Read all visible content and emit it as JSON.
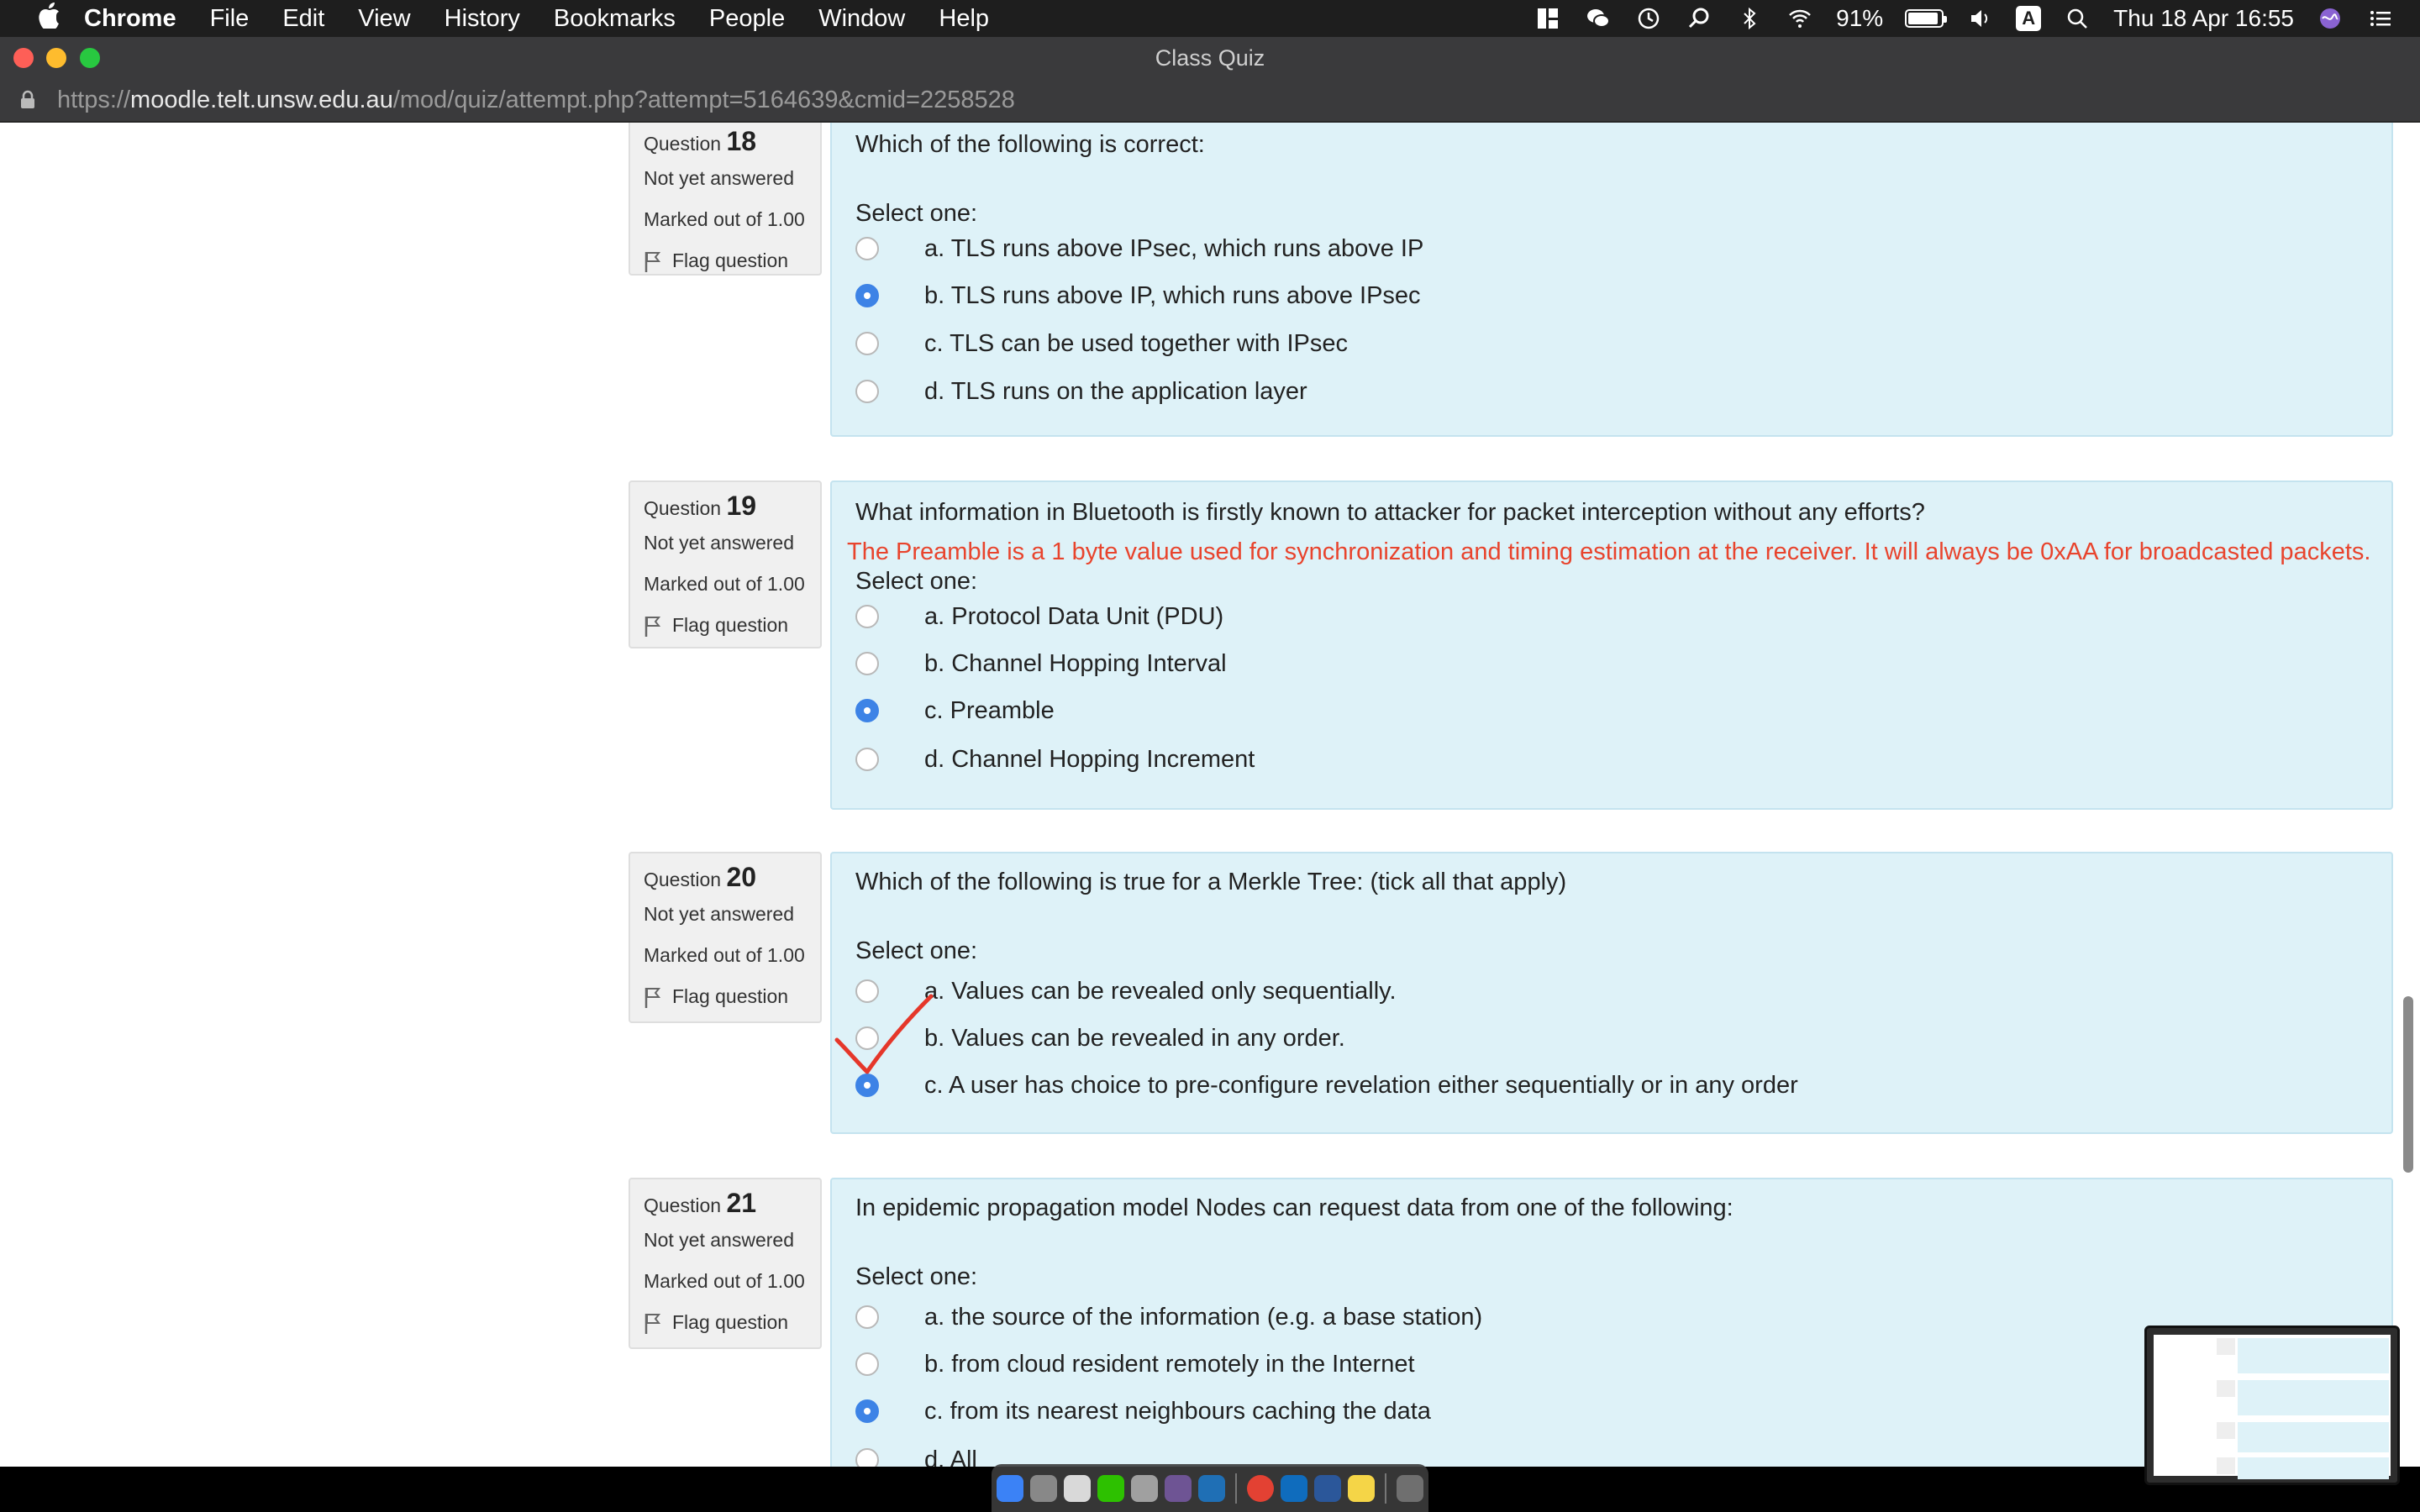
{
  "menubar": {
    "app_name": "Chrome",
    "items": [
      "File",
      "Edit",
      "View",
      "History",
      "Bookmarks",
      "People",
      "Window",
      "Help"
    ],
    "battery": "91%",
    "battery_level": 0.91,
    "ime": "A",
    "datetime": "Thu 18 Apr  16:55",
    "icons": [
      "apple-icon",
      "grid-icon",
      "wechat-icon",
      "time-machine-icon",
      "spotlight-alt-icon",
      "bluetooth-icon",
      "wifi-icon",
      "battery-icon",
      "volume-icon",
      "search-icon",
      "siri-icon",
      "list-icon"
    ]
  },
  "window": {
    "title": "Class Quiz"
  },
  "address": {
    "scheme": "https://",
    "host": "moodle.telt.unsw.edu.au",
    "path": "/mod/quiz/attempt.php?attempt=5164639&cmid=2258528"
  },
  "questions": [
    {
      "label": "Question",
      "number": "18",
      "status": "Not yet answered",
      "marks": "Marked out of 1.00",
      "flag": "Flag question",
      "text": "Which of the following is correct:",
      "hint": "",
      "select": "Select one:",
      "options": [
        {
          "text": "a. TLS runs above IPsec, which runs above IP",
          "checked": false
        },
        {
          "text": "b. TLS runs above IP, which runs above IPsec",
          "checked": true
        },
        {
          "text": "c. TLS can be used together with IPsec",
          "checked": false
        },
        {
          "text": "d. TLS runs on the application layer",
          "checked": false
        }
      ]
    },
    {
      "label": "Question",
      "number": "19",
      "status": "Not yet answered",
      "marks": "Marked out of 1.00",
      "flag": "Flag question",
      "text": "What information in Bluetooth is firstly known to attacker for packet interception without any efforts?",
      "hint": "The Preamble is a 1 byte value used for synchronization and timing estimation at the receiver. It will always be 0xAA for broadcasted packets.",
      "select": "Select one:",
      "options": [
        {
          "text": "a. Protocol Data Unit (PDU)",
          "checked": false
        },
        {
          "text": "b. Channel Hopping Interval",
          "checked": false
        },
        {
          "text": "c. Preamble",
          "checked": true
        },
        {
          "text": "d. Channel Hopping Increment",
          "checked": false
        }
      ]
    },
    {
      "label": "Question",
      "number": "20",
      "status": "Not yet answered",
      "marks": "Marked out of 1.00",
      "flag": "Flag question",
      "text": "Which of the following is true for a Merkle Tree: (tick all that apply)",
      "hint": "",
      "select": "Select one:",
      "options": [
        {
          "text": "a. Values can be revealed only sequentially.",
          "checked": false
        },
        {
          "text": "b. Values can be revealed in any order.",
          "checked": false
        },
        {
          "text": "c. A user has choice to pre-configure revelation either sequentially or in any order",
          "checked": true
        }
      ]
    },
    {
      "label": "Question",
      "number": "21",
      "status": "Not yet answered",
      "marks": "Marked out of 1.00",
      "flag": "Flag question",
      "text": "In epidemic propagation model Nodes can request data from one of the following:",
      "hint": "",
      "select": "Select one:",
      "options": [
        {
          "text": "a. the source of the information (e.g. a base station)",
          "checked": false
        },
        {
          "text": "b. from cloud resident remotely in the Internet",
          "checked": false
        },
        {
          "text": "c. from its nearest neighbours caching the data",
          "checked": true
        },
        {
          "text": "d. All",
          "checked": false
        }
      ]
    }
  ],
  "annotation": {
    "color": "#e5372a"
  },
  "colors": {
    "accent": "#3d83e6",
    "question_bg": "#def2f8",
    "hint": "#e8442d"
  }
}
